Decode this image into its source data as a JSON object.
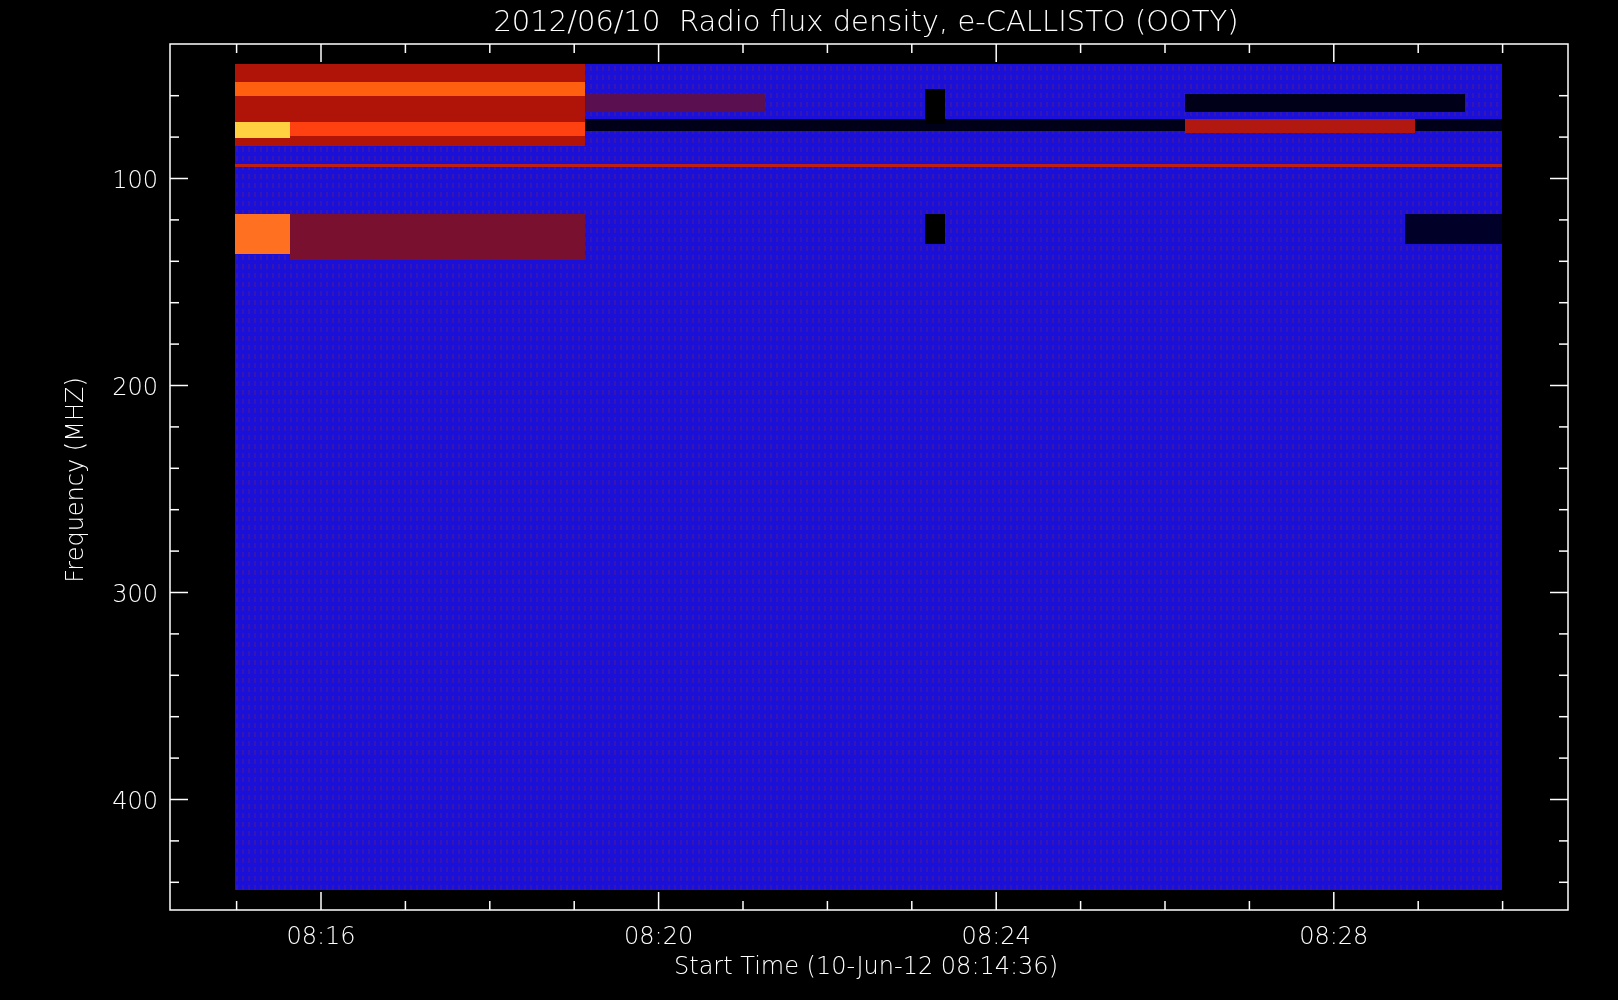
{
  "title": "2012/06/10  Radio flux density, e-CALLISTO (OOTY)",
  "y_axis": {
    "label": "Frequency (MHZ)",
    "ticks": [
      "100",
      "200",
      "300",
      "400"
    ]
  },
  "x_axis": {
    "label": "Start Time (10-Jun-12 08:14:36)",
    "ticks": [
      "08:16",
      "08:20",
      "08:24",
      "08:28"
    ]
  }
}
